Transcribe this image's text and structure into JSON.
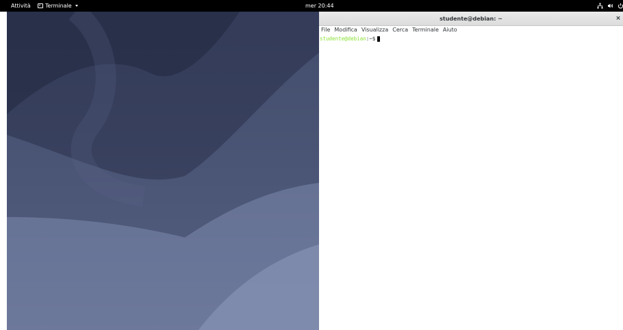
{
  "topbar": {
    "activities": "Attività",
    "app_menu": "Terminale",
    "app_menu_icon": "terminal-icon",
    "clock": "mer 20:44",
    "tray_icons": [
      "network-icon",
      "volume-icon",
      "power-icon",
      "chevron-down-icon"
    ]
  },
  "terminal": {
    "title": "studente@debian: ~",
    "close_label": "×",
    "menu": {
      "file": "File",
      "edit": "Modifica",
      "view": "Visualizza",
      "search": "Cerca",
      "terminal": "Terminale",
      "help": "Aiuto"
    },
    "prompt": {
      "user_host": "studente@debian",
      "path": ":~$"
    }
  },
  "colors": {
    "topbar_bg": "#000000",
    "prompt_user": "#8ae234",
    "wallpaper_dark": "#2d3450",
    "wallpaper_light": "#7e8aab"
  }
}
